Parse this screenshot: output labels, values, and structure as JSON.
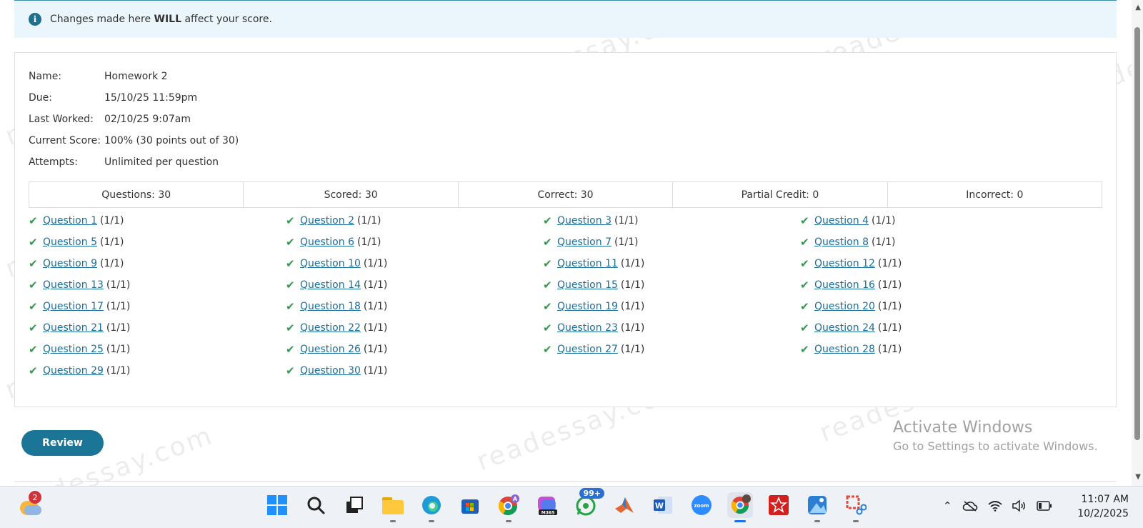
{
  "banner": {
    "prefix": "Changes made here ",
    "bold": "WILL",
    "suffix": " affect your score."
  },
  "assignment": {
    "name_label": "Name:",
    "name": "Homework 2",
    "due_label": "Due:",
    "due": "15/10/25 11:59pm",
    "last_worked_label": "Last Worked:",
    "last_worked": "02/10/25 9:07am",
    "score_label": "Current Score:",
    "score": "100% (30 points out of 30)",
    "attempts_label": "Attempts:",
    "attempts": "Unlimited per question"
  },
  "summary": [
    "Questions: 30",
    "Scored: 30",
    "Correct: 30",
    "Partial Credit: 0",
    "Incorrect: 0"
  ],
  "questions": [
    {
      "label": "Question 1",
      "score": "(1/1)"
    },
    {
      "label": "Question 2",
      "score": "(1/1)"
    },
    {
      "label": "Question 3",
      "score": "(1/1)"
    },
    {
      "label": "Question 4",
      "score": "(1/1)"
    },
    {
      "label": "Question 5",
      "score": "(1/1)"
    },
    {
      "label": "Question 6",
      "score": "(1/1)"
    },
    {
      "label": "Question 7",
      "score": "(1/1)"
    },
    {
      "label": "Question 8",
      "score": "(1/1)"
    },
    {
      "label": "Question 9",
      "score": "(1/1)"
    },
    {
      "label": "Question 10",
      "score": "(1/1)"
    },
    {
      "label": "Question 11",
      "score": "(1/1)"
    },
    {
      "label": "Question 12",
      "score": "(1/1)"
    },
    {
      "label": "Question 13",
      "score": "(1/1)"
    },
    {
      "label": "Question 14",
      "score": "(1/1)"
    },
    {
      "label": "Question 15",
      "score": "(1/1)"
    },
    {
      "label": "Question 16",
      "score": "(1/1)"
    },
    {
      "label": "Question 17",
      "score": "(1/1)"
    },
    {
      "label": "Question 18",
      "score": "(1/1)"
    },
    {
      "label": "Question 19",
      "score": "(1/1)"
    },
    {
      "label": "Question 20",
      "score": "(1/1)"
    },
    {
      "label": "Question 21",
      "score": "(1/1)"
    },
    {
      "label": "Question 22",
      "score": "(1/1)"
    },
    {
      "label": "Question 23",
      "score": "(1/1)"
    },
    {
      "label": "Question 24",
      "score": "(1/1)"
    },
    {
      "label": "Question 25",
      "score": "(1/1)"
    },
    {
      "label": "Question 26",
      "score": "(1/1)"
    },
    {
      "label": "Question 27",
      "score": "(1/1)"
    },
    {
      "label": "Question 28",
      "score": "(1/1)"
    },
    {
      "label": "Question 29",
      "score": "(1/1)"
    },
    {
      "label": "Question 30",
      "score": "(1/1)"
    }
  ],
  "review_button": "Review",
  "activate_windows": {
    "title": "Activate Windows",
    "subtitle": "Go to Settings to activate Windows."
  },
  "watermark": "readessay.com",
  "taskbar": {
    "weather_badge": "2",
    "whatsapp_badge": "99+",
    "time": "11:07 AM",
    "date": "10/2/2025",
    "icons": [
      "windows-start",
      "search",
      "task-view",
      "file-explorer",
      "edge",
      "microsoft-store",
      "chrome-profile",
      "m365-copilot",
      "whatsapp",
      "matlab",
      "word",
      "zoom",
      "chrome",
      "wps-pdf",
      "photos",
      "snipping-tool"
    ]
  },
  "colors": {
    "accent": "#1a7596",
    "link": "#1a6f9c",
    "check": "#2e9a4a",
    "banner_bg": "#eaf6fb"
  }
}
